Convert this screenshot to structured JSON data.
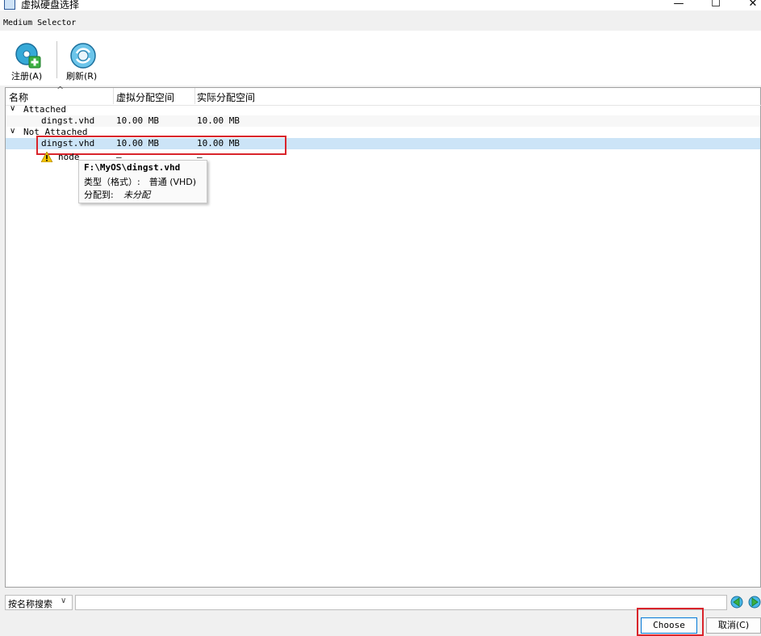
{
  "window": {
    "title": "虚拟硬盘选择",
    "minimize_glyph": "—",
    "maximize_glyph": "☐",
    "close_glyph": "✕"
  },
  "menu_caption": "Medium Selector",
  "toolbar": {
    "register_label": "注册(A)",
    "refresh_label": "刷新(R)"
  },
  "tree": {
    "columns": [
      "名称",
      "虚拟分配空间",
      "实际分配空间"
    ],
    "sort_glyph": "^",
    "groups": [
      {
        "label": "Attached",
        "items": [
          {
            "name": "dingst.vhd",
            "virtual": "10.00 MB",
            "actual": "10.00 MB"
          }
        ]
      },
      {
        "label": "Not Attached",
        "items": [
          {
            "name": "dingst.vhd",
            "virtual": "10.00 MB",
            "actual": "10.00 MB"
          },
          {
            "name": "node",
            "virtual": "—",
            "actual": "—"
          }
        ]
      }
    ]
  },
  "tooltip": {
    "path": "F:\\MyOS\\dingst.vhd",
    "type_line": "类型（格式）:　普通 (VHD)",
    "attached_label": "分配到:",
    "attached_value": "未分配"
  },
  "search": {
    "mode": "按名称搜索",
    "value": ""
  },
  "buttons": {
    "choose": "Choose",
    "cancel": "取消(C)"
  },
  "colors": {
    "selection": "#cce4f7",
    "highlight_box": "#d9242b",
    "register_icon": "#36a9d7",
    "plus_icon": "#3cb043"
  }
}
